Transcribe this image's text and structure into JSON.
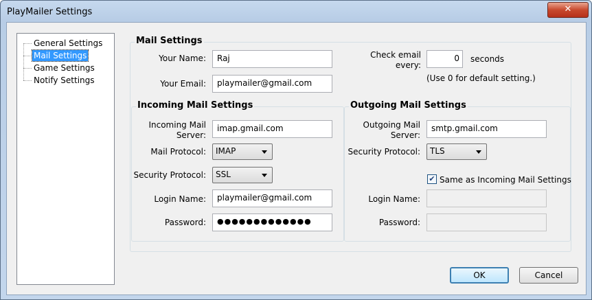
{
  "window": {
    "title": "PlayMailer Settings",
    "close_glyph": "✕"
  },
  "tree": {
    "items": [
      {
        "label": "General Settings",
        "selected": false
      },
      {
        "label": "Mail Settings",
        "selected": true
      },
      {
        "label": "Game Settings",
        "selected": false
      },
      {
        "label": "Notify Settings",
        "selected": false
      }
    ]
  },
  "mail": {
    "legend": "Mail Settings",
    "name_label": "Your Name:",
    "name_value": "Raj",
    "email_label": "Your Email:",
    "email_value": "playmailer@gmail.com",
    "check_label": "Check email every:",
    "check_value": "0",
    "check_unit": "seconds",
    "check_hint": "(Use 0 for default setting.)"
  },
  "incoming": {
    "legend": "Incoming Mail Settings",
    "server_label": "Incoming Mail Server:",
    "server_value": "imap.gmail.com",
    "protocol_label": "Mail Protocol:",
    "protocol_value": "IMAP",
    "security_label": "Security Protocol:",
    "security_value": "SSL",
    "login_label": "Login Name:",
    "login_value": "playmailer@gmail.com",
    "password_label": "Password:",
    "password_value": "●●●●●●●●●●●●●"
  },
  "outgoing": {
    "legend": "Outgoing Mail Settings",
    "server_label": "Outgoing Mail Server:",
    "server_value": "smtp.gmail.com",
    "security_label": "Security Protocol:",
    "security_value": "TLS",
    "same_label": "Same as Incoming Mail Settings",
    "same_checked": true,
    "login_label": "Login Name:",
    "login_value": "",
    "password_label": "Password:",
    "password_value": ""
  },
  "buttons": {
    "ok": "OK",
    "cancel": "Cancel"
  }
}
